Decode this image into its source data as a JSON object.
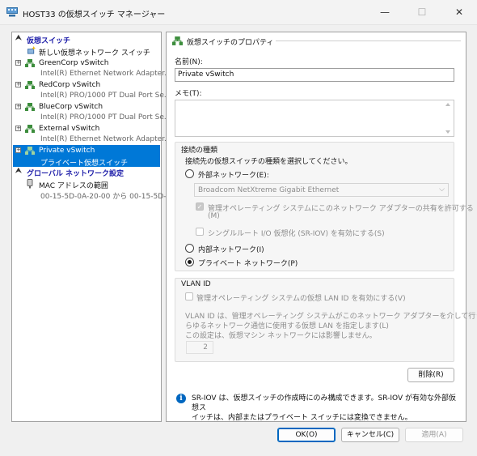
{
  "window": {
    "title": "HOST33 の仮想スイッチ マネージャー",
    "minimize": "—",
    "maximize": "☐",
    "close": "✕"
  },
  "sidebar": {
    "section_virtual_switches": "仮想スイッチ",
    "new_switch": "新しい仮想ネットワーク スイッチ",
    "switches": [
      {
        "name": "GreenCorp vSwitch",
        "detail": "Intel(R) Ethernet Network Adapter..."
      },
      {
        "name": "RedCorp vSwitch",
        "detail": "Intel(R) PRO/1000 PT Dual Port Se..."
      },
      {
        "name": "BlueCorp vSwitch",
        "detail": "Intel(R) PRO/1000 PT Dual Port Se..."
      },
      {
        "name": "External vSwitch",
        "detail": "Intel(R) Ethernet Network Adapter..."
      },
      {
        "name": "Private vSwitch",
        "detail": "プライベート仮想スイッチ"
      }
    ],
    "selected_index": 4,
    "section_global": "グローバル ネットワーク設定",
    "mac_range": {
      "name": "MAC アドレスの範囲",
      "detail": "00-15-5D-0A-20-00 から 00-15-5D-..."
    }
  },
  "properties": {
    "header": "仮想スイッチのプロパティ",
    "name_label": "名前(N):",
    "name_value": "Private vSwitch",
    "memo_label": "メモ(T):",
    "memo_value": ""
  },
  "connection": {
    "group_label": "接続の種類",
    "prompt": "接続先の仮想スイッチの種類を選択してください。",
    "external_label": "外部ネットワーク(E):",
    "adapter_value": "Broadcom NetXtreme Gigabit Ethernet",
    "allow_mgmt_os": "管理オペレーティング システムにこのネットワーク アダプターの共有を許可する",
    "allow_mgmt_os_key": "(M)",
    "sriov_label": "シングルルート I/O 仮想化 (SR-IOV) を有効にする(S)",
    "internal_label": "内部ネットワーク(I)",
    "private_label": "プライベート ネットワーク(P)",
    "selected": "private"
  },
  "vlan": {
    "group_label": "VLAN ID",
    "enable_label": "管理オペレーティング システムの仮想 LAN ID を有効にする(V)",
    "desc_line1": "VLAN ID は、管理オペレーティング システムがこのネットワーク アダプターを介して行うあ",
    "desc_line2": "らゆるネットワーク通信に使用する仮想 LAN を指定します(L)",
    "desc_line3": "この設定は、仮想マシン ネットワークには影響しません。",
    "vlan_value": "2"
  },
  "actions": {
    "delete": "削除(R)",
    "ok": "OK(O)",
    "cancel": "キャンセル(C)",
    "apply": "適用(A)"
  },
  "info": {
    "line1": "SR-IOV は、仮想スイッチの作成時にのみ構成できます。SR-IOV が有効な外部仮想ス",
    "line2": "イッチは、内部またはプライベート スイッチには変換できません。"
  },
  "colors": {
    "selection": "#0078d7",
    "section_header": "#1c1ca8",
    "accent": "#0067c0"
  }
}
